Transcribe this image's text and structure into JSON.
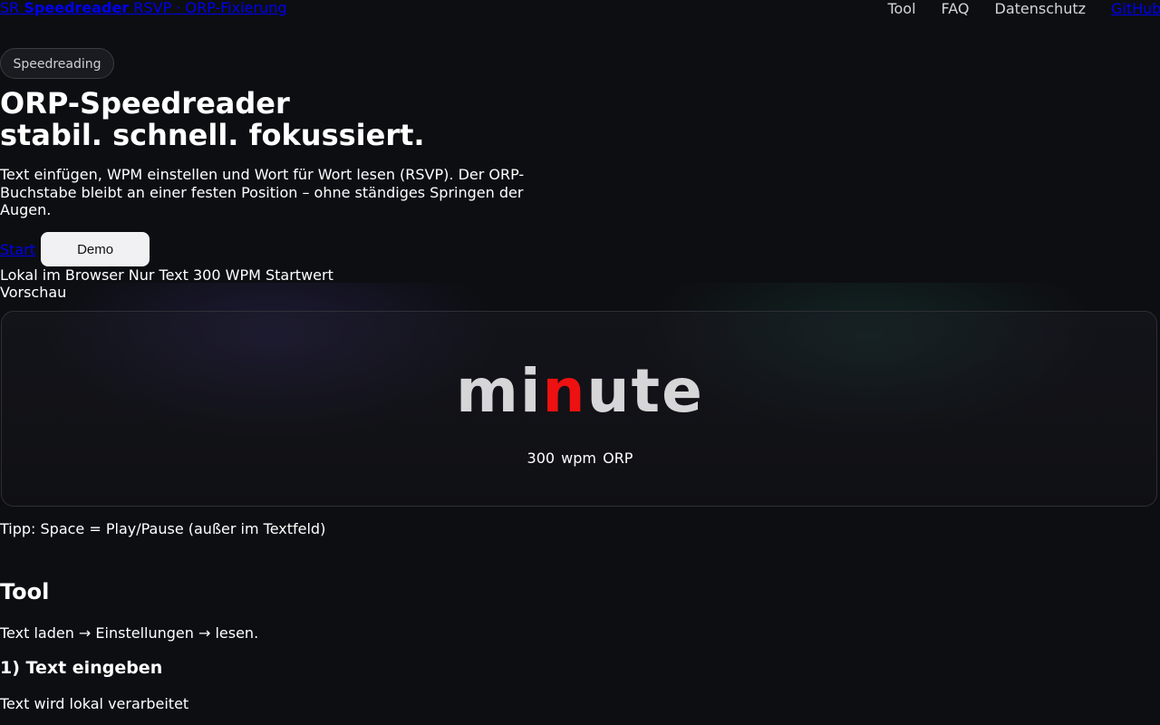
{
  "header": {
    "brand_sr": "SR",
    "brand_name": "Speedreader",
    "brand_tagline": "RSVP · ORP-Fixierung",
    "nav": [
      "Tool",
      "FAQ",
      "Datenschutz"
    ],
    "github_label": "GitHub"
  },
  "hero": {
    "pill": "Speedreading",
    "title_line1": "ORP-Speedreader",
    "title_line2": "stabil. schnell. fokussiert.",
    "description": "Text einfügen, WPM einstellen und Wort für Wort lesen (RSVP). Der ORP-Buchstabe bleibt an einer festen Position – ohne ständiges Springen der Augen.",
    "start_link": "Start",
    "demo_button": "Demo",
    "badges": "Lokal im Browser Nur Text 300 WPM Startwert",
    "preview_label": "Vorschau"
  },
  "preview": {
    "word_before": "mi",
    "word_orp": "n",
    "word_after": "ute",
    "wpm": "300 wpm",
    "orp_label": "ORP",
    "tip": "Tipp: Space = Play/Pause (außer im Textfeld)"
  },
  "tool": {
    "title": "Tool",
    "subtitle": "Text laden → Einstellungen → lesen.",
    "step1_title": "1) Text eingeben",
    "step1_desc": "Text wird lokal verarbeitet"
  },
  "colors": {
    "background": "#0d0e12",
    "orp_letter": "#ee1111",
    "word": "#d6d6d8",
    "link": "#0000ee"
  }
}
